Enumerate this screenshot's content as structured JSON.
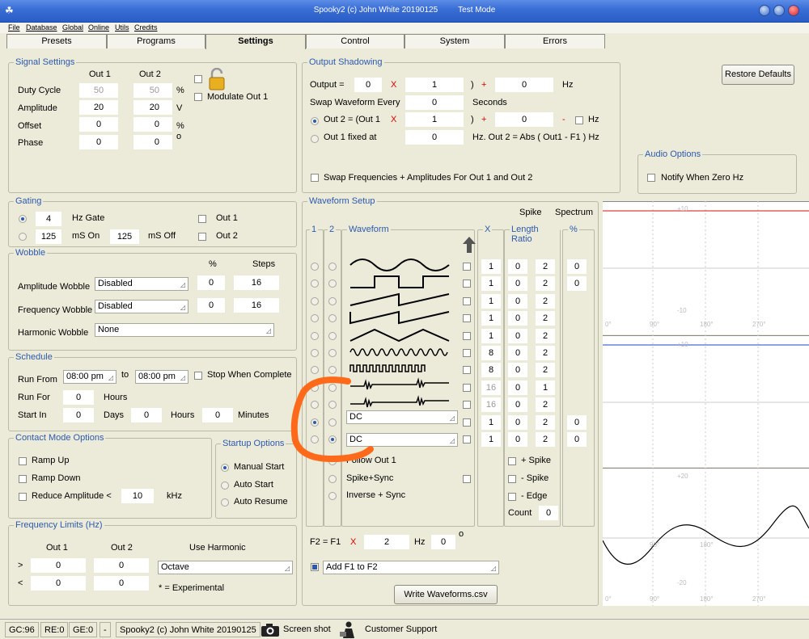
{
  "window": {
    "title": "Spooky2 (c) John White 20190125",
    "mode": "Test Mode"
  },
  "menu": [
    "File",
    "Database",
    "Global",
    "Online",
    "Utils",
    "Credits"
  ],
  "tabs": [
    "Presets",
    "Programs",
    "Settings",
    "Control",
    "System",
    "Errors"
  ],
  "signal": {
    "title": "Signal Settings",
    "out1": "Out 1",
    "out2": "Out 2",
    "rows": [
      {
        "label": "Duty Cycle",
        "v1": "50",
        "v2": "50",
        "unit": "%"
      },
      {
        "label": "Amplitude",
        "v1": "20",
        "v2": "20",
        "unit": "V"
      },
      {
        "label": "Offset",
        "v1": "0",
        "v2": "0",
        "unit": "%"
      },
      {
        "label": "Phase",
        "v1": "0",
        "v2": "0",
        "unit": "o"
      }
    ],
    "modulate": "Modulate Out 1"
  },
  "shadow": {
    "title": "Output Shadowing",
    "output_lbl": "Output =",
    "output_a": "0",
    "output_b": "1",
    "output_c": "0",
    "hz": "Hz",
    "swap_lbl": "Swap Waveform Every",
    "swap_val": "0",
    "seconds": "Seconds",
    "out2_lbl": "Out 2 = (Out 1",
    "out2_a": "1",
    "out2_b": "0",
    "fixed_lbl": "Out 1 fixed at",
    "fixed_val": "0",
    "fixed_txt": "Hz. Out 2 = Abs ( Out1 - F1 ) Hz",
    "swapfreq": "Swap Frequencies + Amplitudes For Out 1 and Out 2",
    "x": "X",
    "plus": "+",
    "paren": ")",
    "minus": "-"
  },
  "restore": "Restore Defaults",
  "audio": {
    "title": "Audio Options",
    "notify": "Notify When Zero Hz"
  },
  "gating": {
    "title": "Gating",
    "gate_val": "4",
    "gate_lbl": "Hz Gate",
    "on_val": "125",
    "on_lbl": "mS On",
    "off_val": "125",
    "off_lbl": "mS Off",
    "out1": "Out 1",
    "out2": "Out 2"
  },
  "wobble": {
    "title": "Wobble",
    "pct": "%",
    "steps": "Steps",
    "rows": [
      {
        "label": "Amplitude Wobble",
        "sel": "Disabled",
        "pct": "0",
        "steps": "16"
      },
      {
        "label": "Frequency Wobble",
        "sel": "Disabled",
        "pct": "0",
        "steps": "16"
      }
    ],
    "harmonic_lbl": "Harmonic Wobble",
    "harmonic": "None"
  },
  "schedule": {
    "title": "Schedule",
    "run_from": "Run From",
    "from": "08:00 pm",
    "to_lbl": "to",
    "to": "08:00 pm",
    "stop": "Stop When Complete",
    "run_for": "Run For",
    "run_for_val": "0",
    "hours": "Hours",
    "start_in": "Start In",
    "days_val": "0",
    "days": "Days",
    "hrs_val": "0",
    "min_val": "0",
    "minutes": "Minutes"
  },
  "contact": {
    "title": "Contact Mode Options",
    "ramp_up": "Ramp Up",
    "ramp_down": "Ramp Down",
    "reduce": "Reduce Amplitude <",
    "reduce_val": "10",
    "khz": "kHz"
  },
  "startup": {
    "title": "Startup Options",
    "options": [
      "Manual Start",
      "Auto Start",
      "Auto Resume"
    ]
  },
  "freq": {
    "title": "Frequency Limits (Hz)",
    "out1": "Out 1",
    "out2": "Out 2",
    "use_harmonic": "Use Harmonic",
    "gt": ">",
    "lt": "<",
    "v": [
      "0",
      "0",
      "0",
      "0"
    ],
    "harmonic": "Octave",
    "note": "* = Experimental"
  },
  "waveform": {
    "title": "Waveform Setup",
    "spike": "Spike",
    "spectrum": "Spectrum",
    "col1": "1",
    "col2": "2",
    "col_wave": "Waveform",
    "col_x": "X",
    "col_len": "Length Ratio",
    "col_pct": "%",
    "rows": [
      {
        "x": "1",
        "a": "0",
        "b": "2",
        "p": "0"
      },
      {
        "x": "1",
        "a": "0",
        "b": "2",
        "p": "0"
      },
      {
        "x": "1",
        "a": "0",
        "b": "2",
        "p": ""
      },
      {
        "x": "1",
        "a": "0",
        "b": "2",
        "p": ""
      },
      {
        "x": "1",
        "a": "0",
        "b": "2",
        "p": ""
      },
      {
        "x": "8",
        "a": "0",
        "b": "2",
        "p": ""
      },
      {
        "x": "8",
        "a": "0",
        "b": "2",
        "p": ""
      },
      {
        "x": "16",
        "a": "0",
        "b": "1",
        "p": ""
      },
      {
        "x": "16",
        "a": "0",
        "b": "2",
        "p": ""
      },
      {
        "x": "1",
        "a": "0",
        "b": "2",
        "p": "0"
      },
      {
        "x": "1",
        "a": "0",
        "b": "2",
        "p": "0"
      }
    ],
    "dc1": "DC",
    "dc2": "DC",
    "follow": "Follow Out 1",
    "spike_sync": "Spike+Sync",
    "inverse": "Inverse + Sync",
    "plus_spike": "+ Spike",
    "minus_spike": "- Spike",
    "edge": "- Edge",
    "count": "Count",
    "count_val": "0",
    "f2_lbl": "F2 = F1",
    "f2_x": "X",
    "f2_val": "2",
    "f2_hz": "Hz",
    "f2_deg": "0",
    "f2_o": "o",
    "add": "Add F1 to F2",
    "write": "Write Waveforms.csv"
  },
  "scopes": {
    "top_label": "+10",
    "mid_label": "-10",
    "ticks": [
      "0°",
      "90°",
      "180°",
      "270°"
    ],
    "neg20": "-20",
    "pos20": "+20"
  },
  "status": {
    "gc": "GC:96",
    "re": "RE:0",
    "ge": "GE:0",
    "dash": "-",
    "copy": "Spooky2 (c) John White 20190125",
    "screenshot": "Screen shot",
    "support": "Customer Support"
  },
  "colors": {
    "accent": "#2c5ab0",
    "highlight": "#ff6a1a",
    "scope1": "#e04040",
    "scope2": "#4a6ad8"
  }
}
